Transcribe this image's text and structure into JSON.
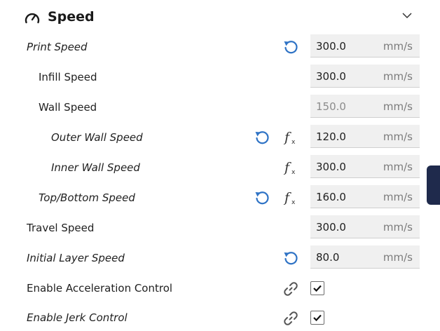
{
  "header": {
    "title": "Speed",
    "icon": "speedometer-icon",
    "collapse_icon": "chevron-down-icon"
  },
  "colors": {
    "accent": "#2f73c5",
    "field_bg": "#f0f0f0",
    "side_tab": "#1f2a4c"
  },
  "rows": [
    {
      "label": "Print Speed",
      "value": "300.0",
      "unit": "mm/s",
      "modified": true
    },
    {
      "label": "Infill Speed",
      "value": "300.0",
      "unit": "mm/s"
    },
    {
      "label": "Wall Speed",
      "value": "150.0",
      "unit": "mm/s",
      "disabled": true
    },
    {
      "label": "Outer Wall Speed",
      "value": "120.0",
      "unit": "mm/s",
      "modified": true,
      "function": true
    },
    {
      "label": "Inner Wall Speed",
      "value": "300.0",
      "unit": "mm/s",
      "function": true
    },
    {
      "label": "Top/Bottom Speed",
      "value": "160.0",
      "unit": "mm/s",
      "modified": true,
      "function": true
    },
    {
      "label": "Travel Speed",
      "value": "300.0",
      "unit": "mm/s"
    },
    {
      "label": "Initial Layer Speed",
      "value": "80.0",
      "unit": "mm/s",
      "modified": true
    },
    {
      "label": "Enable Acceleration Control",
      "checked": true,
      "linked": true
    },
    {
      "label": "Enable Jerk Control",
      "checked": true,
      "linked": true
    }
  ]
}
